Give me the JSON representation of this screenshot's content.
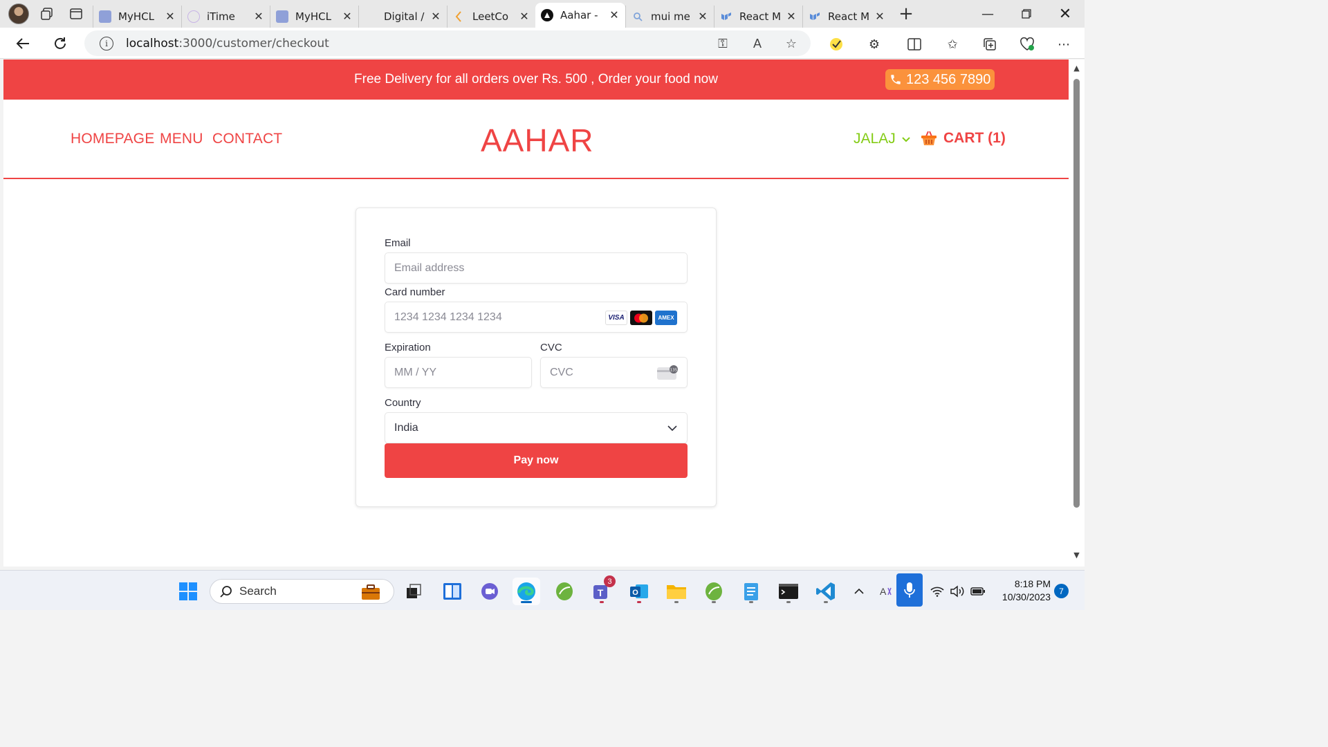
{
  "browser": {
    "tabs": [
      {
        "title": "MyHCL",
        "favicon": "myhcl-icon",
        "color": "#8fa0d8"
      },
      {
        "title": "iTime",
        "favicon": "timer-icon",
        "color": "#c8b4e6"
      },
      {
        "title": "MyHCL",
        "favicon": "myhcl-icon",
        "color": "#8fa0d8"
      },
      {
        "title": "Digital /",
        "favicon": "",
        "color": "#ffffff"
      },
      {
        "title": "LeetCo",
        "favicon": "leetcode-icon",
        "color": "#f0a030"
      },
      {
        "title": "Aahar -",
        "favicon": "aahar-icon",
        "color": "#111111"
      },
      {
        "title": "mui me",
        "favicon": "search-icon",
        "color": "#7fa3d9"
      },
      {
        "title": "React M",
        "favicon": "mui-icon",
        "color": "#5b8dd9"
      },
      {
        "title": "React M",
        "favicon": "mui-icon",
        "color": "#5b8dd9"
      }
    ],
    "active_tab": 5,
    "url_host": "localhost",
    "url_path": ":3000/customer/checkout"
  },
  "promo": {
    "text": "Free Delivery for all orders over Rs. 500 , Order your food now",
    "phone": "123 456 7890"
  },
  "nav": {
    "links": [
      "HOMEPAGE",
      "MENU",
      "CONTACT"
    ],
    "logo": "AAHAR",
    "user": "JALAJ",
    "cart": "CART (1)"
  },
  "checkout": {
    "email_label": "Email",
    "email_placeholder": "Email address",
    "card_label": "Card number",
    "card_placeholder": "1234 1234 1234 1234",
    "card_brands": [
      "VISA",
      "mastercard",
      "AMEX"
    ],
    "expiry_label": "Expiration",
    "expiry_placeholder": "MM / YY",
    "cvc_label": "CVC",
    "cvc_placeholder": "CVC",
    "country_label": "Country",
    "country_value": "India",
    "pay_button": "Pay now"
  },
  "taskbar": {
    "search_placeholder": "Search",
    "teams_badge": "3",
    "time": "8:18 PM",
    "date": "10/30/2023",
    "notifications": "7"
  },
  "colors": {
    "accent": "#ef4444",
    "phone_badge": "#fb923c",
    "user": "#84cc16"
  }
}
